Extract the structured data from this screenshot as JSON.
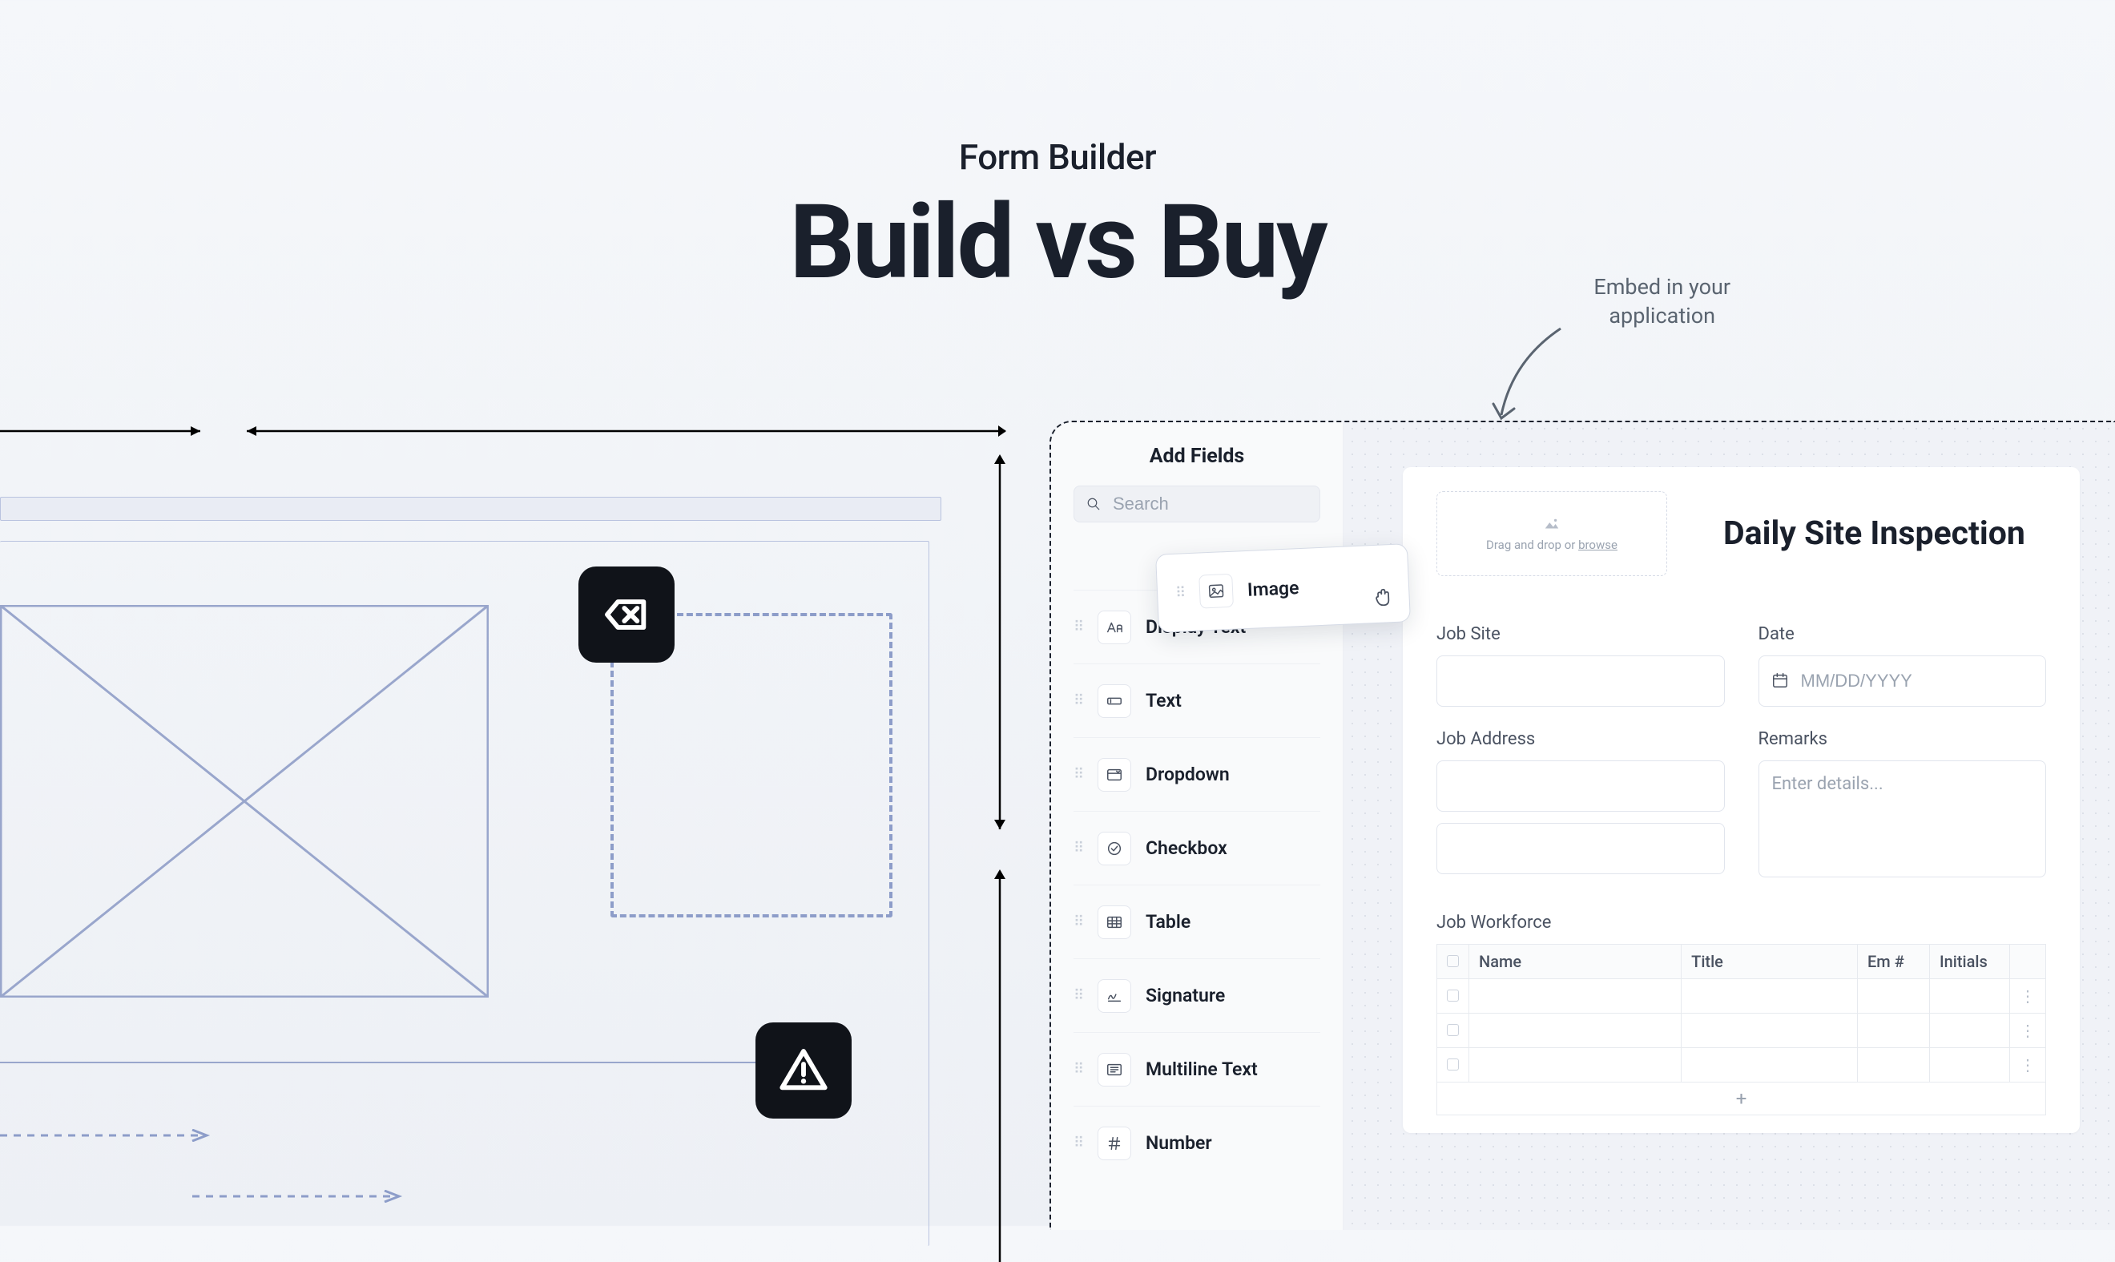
{
  "headline": {
    "subtitle": "Form Builder",
    "title": "Build vs Buy"
  },
  "annotation": {
    "embed_line1": "Embed in your",
    "embed_line2": "application"
  },
  "sidebar": {
    "title": "Add Fields",
    "search_placeholder": "Search",
    "floating_item": "Image",
    "items": [
      {
        "label": "Display Text",
        "icon": "text-aa"
      },
      {
        "label": "Text",
        "icon": "text-field"
      },
      {
        "label": "Dropdown",
        "icon": "dropdown"
      },
      {
        "label": "Checkbox",
        "icon": "checkbox"
      },
      {
        "label": "Table",
        "icon": "table"
      },
      {
        "label": "Signature",
        "icon": "signature"
      },
      {
        "label": "Multiline Text",
        "icon": "multiline"
      },
      {
        "label": "Number",
        "icon": "hash"
      }
    ]
  },
  "form": {
    "dropzone_prefix": "Drag and drop or ",
    "dropzone_link": "browse",
    "title": "Daily Site Inspection",
    "labels": {
      "job_site": "Job Site",
      "date": "Date",
      "job_address": "Job Address",
      "remarks": "Remarks",
      "job_workforce": "Job Workforce"
    },
    "placeholders": {
      "date": "MM/DD/YYYY",
      "remarks": "Enter details..."
    },
    "table": {
      "headers": [
        "Name",
        "Title",
        "Em #",
        "Initials"
      ]
    }
  }
}
